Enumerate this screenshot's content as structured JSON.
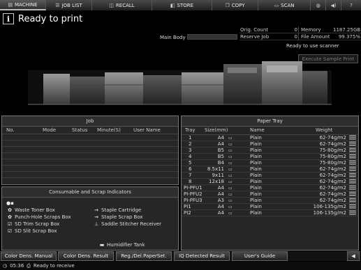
{
  "tabs": [
    {
      "label": "MACHINE",
      "icon": "printer-icon",
      "active": true
    },
    {
      "label": "JOB LIST",
      "icon": "job-list-icon",
      "active": false
    },
    {
      "label": "RECALL",
      "icon": "recall-icon",
      "active": false
    },
    {
      "label": "STORE",
      "icon": "store-icon",
      "active": false
    },
    {
      "label": "COPY",
      "icon": "copy-icon",
      "active": false
    },
    {
      "label": "SCAN",
      "icon": "scan-icon",
      "active": false
    }
  ],
  "tab_icons": [
    "globe-icon",
    "speaker-icon",
    "help-icon"
  ],
  "header": {
    "status": "Ready to print",
    "main_body_label": "Main Body",
    "scanner_status": "Ready to use scanner",
    "exec_sample": "Execute Sample Print"
  },
  "counters": {
    "orig_count_label": "Orig. Count",
    "orig_count_value": "0",
    "memory_label": "Memory",
    "memory_value": "1187.25GB",
    "reserve_job_label": "Reserve Job",
    "reserve_job_value": "0",
    "file_amount_label": "File Amount",
    "file_amount_value": "99.375%"
  },
  "job": {
    "title": "Job",
    "columns": [
      "No.",
      "Mode",
      "Status",
      "Minute(S)",
      "User Name"
    ]
  },
  "consumables": {
    "title": "Consumable and Scrap Indicators",
    "items": [
      {
        "label": "Waste Toner Box",
        "icon": "waste-toner-icon"
      },
      {
        "label": "Punch-Hole Scraps Box",
        "icon": "punch-scraps-icon"
      },
      {
        "label": "SD Trim Scrap Box",
        "icon": "trim-scrap-icon"
      },
      {
        "label": "SD Slit Scrap Box",
        "icon": "slit-scrap-icon"
      },
      {
        "label": "Staple Cartridge",
        "icon": "staple-icon"
      },
      {
        "label": "Staple Scrap Box",
        "icon": "staple-scrap-icon"
      },
      {
        "label": "Saddle Stitcher Receiver",
        "icon": "saddle-stitcher-icon"
      },
      {
        "label": "Humidifier Tank",
        "icon": "humidifier-icon"
      }
    ]
  },
  "paper_tray": {
    "title": "Paper Tray",
    "columns": [
      "Tray",
      "Size(mm)",
      "Name",
      "Weight"
    ],
    "rows": [
      {
        "tray": "1",
        "size": "A4",
        "name": "Plain",
        "weight": "62-74g/m2"
      },
      {
        "tray": "2",
        "size": "A4",
        "name": "Plain",
        "weight": "62-74g/m2"
      },
      {
        "tray": "3",
        "size": "B5",
        "name": "Plain",
        "weight": "75-80g/m2"
      },
      {
        "tray": "4",
        "size": "B5",
        "name": "Plain",
        "weight": "75-80g/m2"
      },
      {
        "tray": "5",
        "size": "B4",
        "name": "Plain",
        "weight": "75-80g/m2"
      },
      {
        "tray": "6",
        "size": "8.5x11",
        "name": "Plain",
        "weight": "62-74g/m2"
      },
      {
        "tray": "7",
        "size": "9x11",
        "name": "Plain",
        "weight": "62-74g/m2"
      },
      {
        "tray": "8",
        "size": "12x18",
        "name": "Plain",
        "weight": "62-74g/m2"
      },
      {
        "tray": "PI-PFU1",
        "size": "A4",
        "name": "Plain",
        "weight": "62-74g/m2"
      },
      {
        "tray": "PI-PFU2",
        "size": "A4",
        "name": "Plain",
        "weight": "62-74g/m2"
      },
      {
        "tray": "PI-PFU3",
        "size": "A3",
        "name": "Plain",
        "weight": "62-74g/m2"
      },
      {
        "tray": "PI1",
        "size": "A4",
        "name": "Plain",
        "weight": "106-135g/m2"
      },
      {
        "tray": "PI2",
        "size": "A4",
        "name": "Plain",
        "weight": "106-135g/m2"
      }
    ]
  },
  "bottom_buttons": [
    "Color Dens. Manual",
    "Color Dens. Result",
    "Reg./Del.PaperSet.",
    "IQ Detected Result",
    "User's Guide"
  ],
  "footer": {
    "time": "05:36",
    "status": "Ready to receive"
  }
}
